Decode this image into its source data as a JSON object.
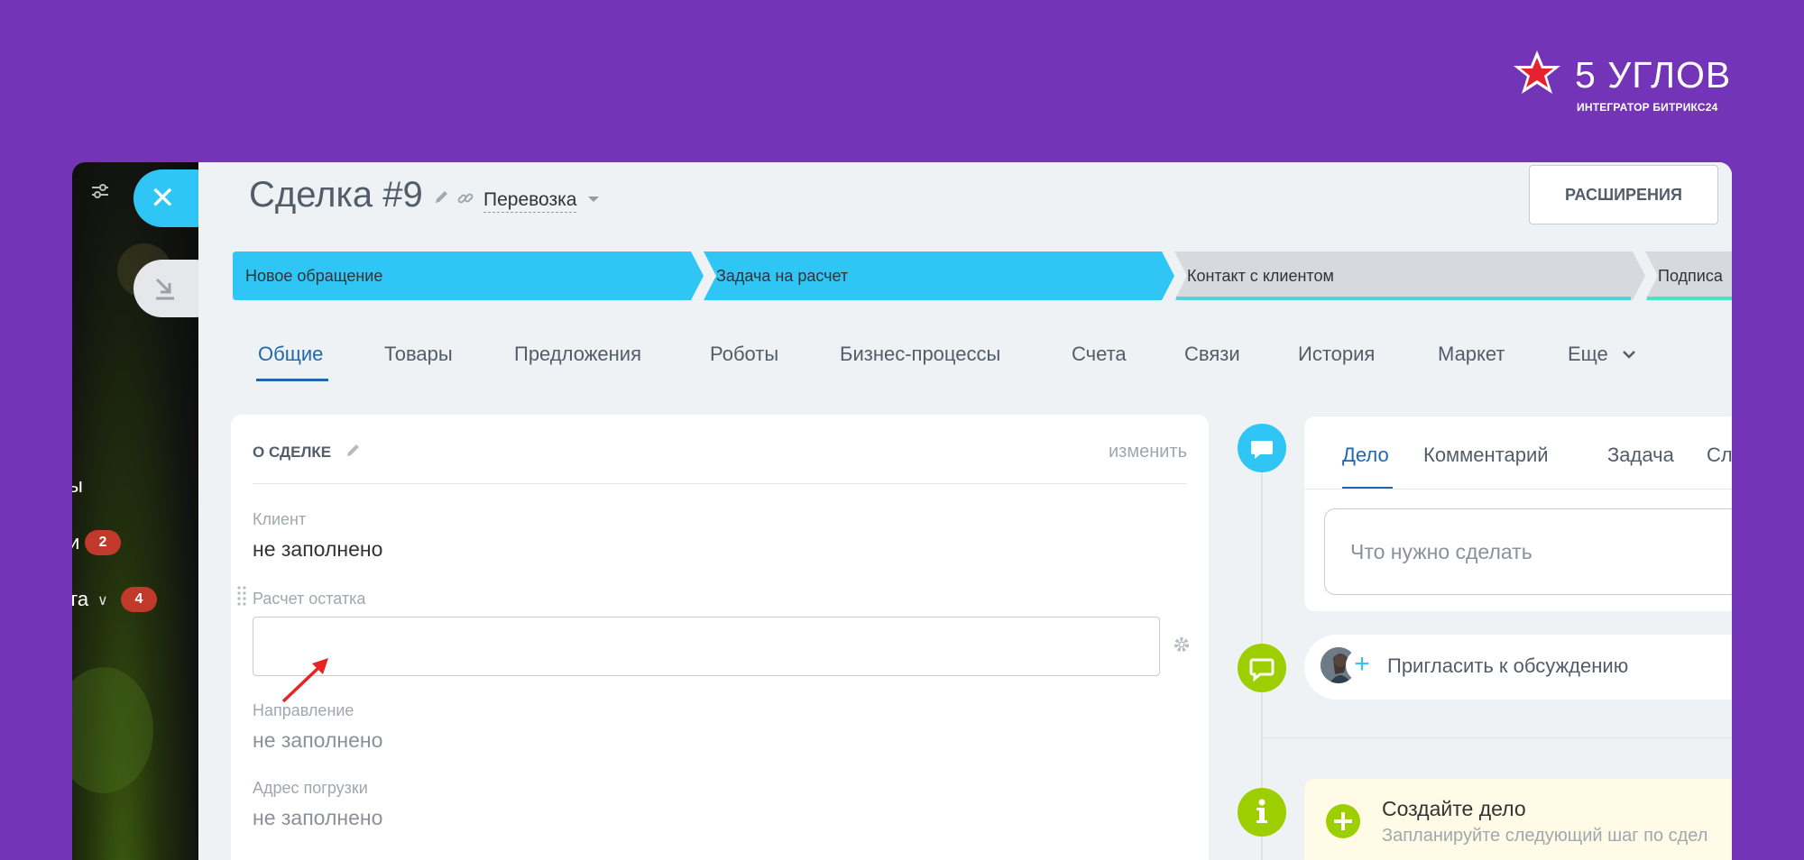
{
  "logo": {
    "title": "5 УГЛОВ",
    "subtitle": "ИНТЕГРАТОР БИТРИКС24"
  },
  "portal": {
    "items": [
      {
        "label": "ы"
      },
      {
        "label": "и",
        "badge": "2"
      },
      {
        "label": "та",
        "badge": "4"
      }
    ]
  },
  "header": {
    "deal_title": "Сделка #9",
    "category": "Перевозка",
    "extensions_button": "РАСШИРЕНИЯ"
  },
  "stages": [
    {
      "label": "Новое обращение",
      "color": "#2fc6f6",
      "underline": ""
    },
    {
      "label": "Задача на расчет",
      "color": "#2fc6f6",
      "underline": ""
    },
    {
      "label": "Контакт с клиентом",
      "color": "#d6d9de",
      "underline": "#56d1e0"
    },
    {
      "label": "Подписа",
      "color": "#d6d9de",
      "underline": "#47e4c2"
    }
  ],
  "tabs": [
    {
      "label": "Общие"
    },
    {
      "label": "Товары"
    },
    {
      "label": "Предложения"
    },
    {
      "label": "Роботы"
    },
    {
      "label": "Бизнес-процессы"
    },
    {
      "label": "Счета"
    },
    {
      "label": "Связи"
    },
    {
      "label": "История"
    },
    {
      "label": "Маркет"
    },
    {
      "label": "Еще"
    }
  ],
  "about": {
    "title": "О СДЕЛКЕ",
    "edit_link": "изменить",
    "fields": [
      {
        "label": "Клиент",
        "value": "не заполнено"
      },
      {
        "label": "Расчет остатка",
        "value": ""
      },
      {
        "label": "Направление",
        "value": "не заполнено"
      },
      {
        "label": "Адрес погрузки",
        "value": "не заполнено"
      }
    ]
  },
  "activity": {
    "tabs": [
      {
        "label": "Дело"
      },
      {
        "label": "Комментарий"
      },
      {
        "label": "Задача"
      },
      {
        "label": "Слот"
      }
    ],
    "input_placeholder": "Что нужно сделать",
    "invite_text": "Пригласить к обсуждению",
    "create_title": "Создайте дело",
    "create_subtitle": "Запланируйте следующий шаг по сдел"
  },
  "colors": {
    "background": "#7434b7",
    "accent": "#2fc6f6",
    "link": "#2067b0",
    "badge": "#c0392b",
    "timeline_green": "#9dcf00"
  }
}
